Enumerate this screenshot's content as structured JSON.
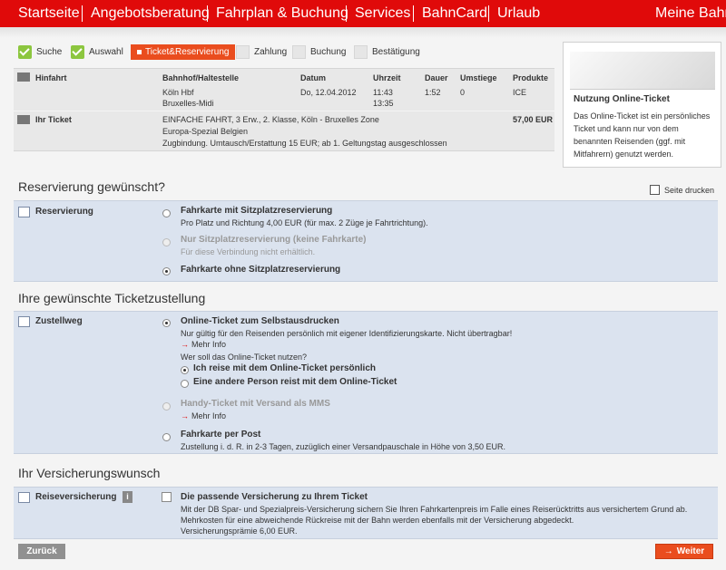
{
  "nav": {
    "items": [
      "Startseite",
      "Angebotsberatung",
      "Fahrplan & Buchung",
      "Services",
      "BahnCard",
      "Urlaub"
    ],
    "right": "Meine Bahn"
  },
  "steps": [
    {
      "label": "Suche",
      "state": "done"
    },
    {
      "label": "Auswahl",
      "state": "done"
    },
    {
      "label": "Ticket&Reservierung",
      "state": "active"
    },
    {
      "label": "Zahlung",
      "state": "todo"
    },
    {
      "label": "Buchung",
      "state": "todo"
    },
    {
      "label": "Bestätigung",
      "state": "todo"
    }
  ],
  "journey": {
    "header": {
      "label": "Hinfahrt",
      "station": "Bahnhof/Haltestelle",
      "date": "Datum",
      "time": "Uhrzeit",
      "duration": "Dauer",
      "changes": "Umstiege",
      "products": "Produkte"
    },
    "from": "Köln Hbf",
    "to": "Bruxelles-Midi",
    "date": "Do, 12.04.2012",
    "dep": "11:43",
    "arr": "13:35",
    "duration": "1:52",
    "changes": "0",
    "product": "ICE"
  },
  "ticket": {
    "label": "Ihr Ticket",
    "line1": "EINFACHE FAHRT, 3 Erw., 2. Klasse, Köln - Bruxelles Zone",
    "line2": "Europa-Spezial Belgien",
    "line3": "Zugbindung. Umtausch/Erstattung 15 EUR; ab 1. Geltungstag ausgeschlossen",
    "price": "57,00 EUR"
  },
  "side": {
    "title": "Nutzung Online-Ticket",
    "text": "Das Online-Ticket ist ein persönliches Ticket und kann nur von dem benannten Reisenden (ggf. mit Mitfahrern) genutzt werden."
  },
  "reservation": {
    "heading": "Reservierung gewünscht?",
    "print": "Seite drucken",
    "label": "Reservierung",
    "options": [
      {
        "title": "Fahrkarte mit Sitzplatzreservierung",
        "desc": "Pro Platz und Richtung 4,00 EUR (für max. 2 Züge je Fahrtrichtung).",
        "state": "off"
      },
      {
        "title": "Nur Sitzplatzreservierung (keine Fahrkarte)",
        "desc": "Für diese Verbindung nicht erhältlich.",
        "state": "disabled"
      },
      {
        "title": "Fahrkarte ohne Sitzplatzreservierung",
        "desc": "",
        "state": "on"
      }
    ]
  },
  "delivery": {
    "heading": "Ihre gewünschte Ticketzustellung",
    "label": "Zustellweg",
    "online": {
      "title": "Online-Ticket zum Selbstausdrucken",
      "desc": "Nur gültig für den Reisenden persönlich mit eigener Identifizierungskarte. Nicht übertragbar!",
      "more": "Mehr Info",
      "question": "Wer soll das Online-Ticket nutzen?",
      "sub1": "Ich reise mit dem Online-Ticket persönlich",
      "sub2": "Eine andere Person reist mit dem Online-Ticket"
    },
    "handy": {
      "title": "Handy-Ticket mit Versand als MMS",
      "more": "Mehr Info"
    },
    "post": {
      "title": "Fahrkarte per Post",
      "desc": "Zustellung i. d. R. in 2-3 Tagen, zuzüglich einer Versandpauschale in Höhe von 3,50 EUR."
    }
  },
  "insurance": {
    "heading": "Ihr Versicherungswunsch",
    "label": "Reiseversicherung",
    "info": "i",
    "title": "Die passende Versicherung zu Ihrem Ticket",
    "desc1": "Mit der DB Spar- und Spezialpreis-Versicherung sichern Sie Ihren Fahrkartenpreis im Falle eines Reiserücktritts aus versichertem Grund ab.",
    "desc2": "Mehrkosten für eine abweichende Rückreise mit der Bahn werden ebenfalls mit der Versicherung abgedeckt.",
    "desc3": "Versicherungsprämie 6,00 EUR."
  },
  "buttons": {
    "back": "Zurück",
    "next": "Weiter",
    "next_arrow": "→"
  },
  "icons": {
    "more": "→"
  }
}
